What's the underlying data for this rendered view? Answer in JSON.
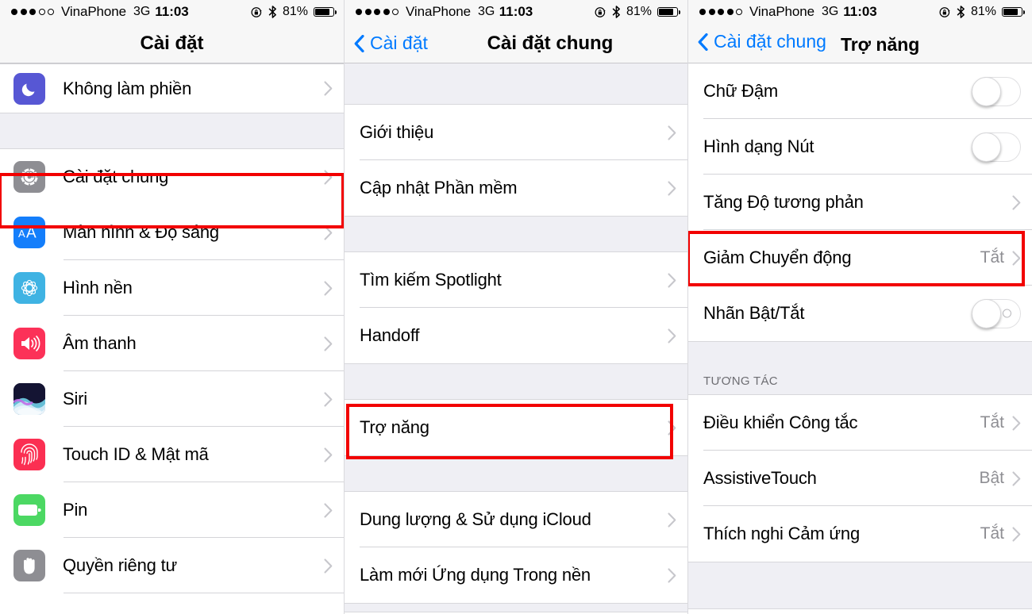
{
  "statusbar": {
    "carrier": "VinaPhone",
    "network": "3G",
    "time": "11:03",
    "battery_percent": "81%",
    "signal_dots_p1": 3,
    "signal_dots_p2": 4,
    "signal_dots_p3": 4,
    "icons": [
      "rotation-lock-icon",
      "bluetooth-icon",
      "battery-icon"
    ]
  },
  "accent_color": "#007aff",
  "highlight_color": "#f20000",
  "panel1": {
    "title": "Cài đặt",
    "rows": [
      {
        "label": "Không làm phiền",
        "icon": "do-not-disturb-icon"
      },
      {
        "label": "Cài đặt chung",
        "icon": "gear-icon"
      },
      {
        "label": "Màn hình & Độ sáng",
        "icon": "display-brightness-icon"
      },
      {
        "label": "Hình nền",
        "icon": "wallpaper-icon"
      },
      {
        "label": "Âm thanh",
        "icon": "sound-icon"
      },
      {
        "label": "Siri",
        "icon": "siri-icon"
      },
      {
        "label": "Touch ID & Mật mã",
        "icon": "touch-id-icon"
      },
      {
        "label": "Pin",
        "icon": "battery-icon"
      },
      {
        "label": "Quyền riêng tư",
        "icon": "privacy-hand-icon"
      }
    ]
  },
  "panel2": {
    "back_label": "Cài đặt",
    "title": "Cài đặt chung",
    "group1": [
      {
        "label": "Giới thiệu"
      },
      {
        "label": "Cập nhật Phần mềm"
      }
    ],
    "group2": [
      {
        "label": "Tìm kiếm Spotlight"
      },
      {
        "label": "Handoff"
      }
    ],
    "group3": [
      {
        "label": "Trợ năng"
      }
    ],
    "group4": [
      {
        "label": "Dung lượng & Sử dụng iCloud"
      },
      {
        "label": "Làm mới Ứng dụng Trong nền"
      }
    ]
  },
  "panel3": {
    "back_label": "Cài đặt chung",
    "title": "Trợ năng",
    "group1": [
      {
        "label": "Chữ Đậm",
        "control": "toggle",
        "state": "off"
      },
      {
        "label": "Hình dạng Nút",
        "control": "toggle",
        "state": "off"
      },
      {
        "label": "Tăng Độ tương phản",
        "control": "chevron"
      },
      {
        "label": "Giảm Chuyển động",
        "control": "value",
        "value": "Tắt"
      },
      {
        "label": "Nhãn Bật/Tắt",
        "control": "toggle-labeled",
        "state": "off"
      }
    ],
    "section_header": "TƯƠNG TÁC",
    "group2": [
      {
        "label": "Điều khiển Công tắc",
        "control": "value",
        "value": "Tắt"
      },
      {
        "label": "AssistiveTouch",
        "control": "value",
        "value": "Bật"
      },
      {
        "label": "Thích nghi Cảm ứng",
        "control": "value",
        "value": "Tắt"
      }
    ]
  }
}
